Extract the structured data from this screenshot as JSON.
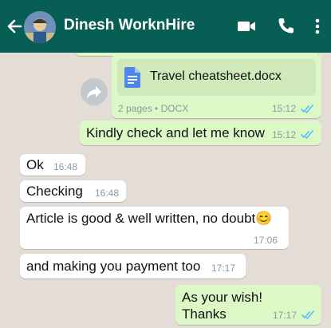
{
  "contact": {
    "name": "Dinesh WorknHire"
  },
  "messages": {
    "doc": {
      "filename": "Travel cheatsheet.docx",
      "pages": "2 pages",
      "separator": "•",
      "type": "DOCX",
      "time": "15:12"
    },
    "m1": {
      "text": "Kindly check and let me know",
      "time": "15:12"
    },
    "m2": {
      "text": "Ok",
      "time": "16:48"
    },
    "m3": {
      "text": "Checking",
      "time": "16:48"
    },
    "m4": {
      "text": "Article is good & well written, no doubt",
      "emoji": "😊",
      "time": "17:06"
    },
    "m5": {
      "text": "and making you payment too",
      "time": "17:17"
    },
    "m6": {
      "line1": "As your wish!",
      "line2": "Thanks",
      "time": "17:17"
    }
  },
  "colors": {
    "header": "#075e54",
    "chat_bg": "#e4ddd5",
    "outgoing": "#dcf8c6",
    "incoming": "#ffffff",
    "read_ticks": "#4fc3f7"
  },
  "icons": {
    "back": "arrow-left-icon",
    "video": "video-call-icon",
    "call": "phone-icon",
    "menu": "more-vert-icon",
    "forward": "forward-icon",
    "document": "document-icon"
  }
}
